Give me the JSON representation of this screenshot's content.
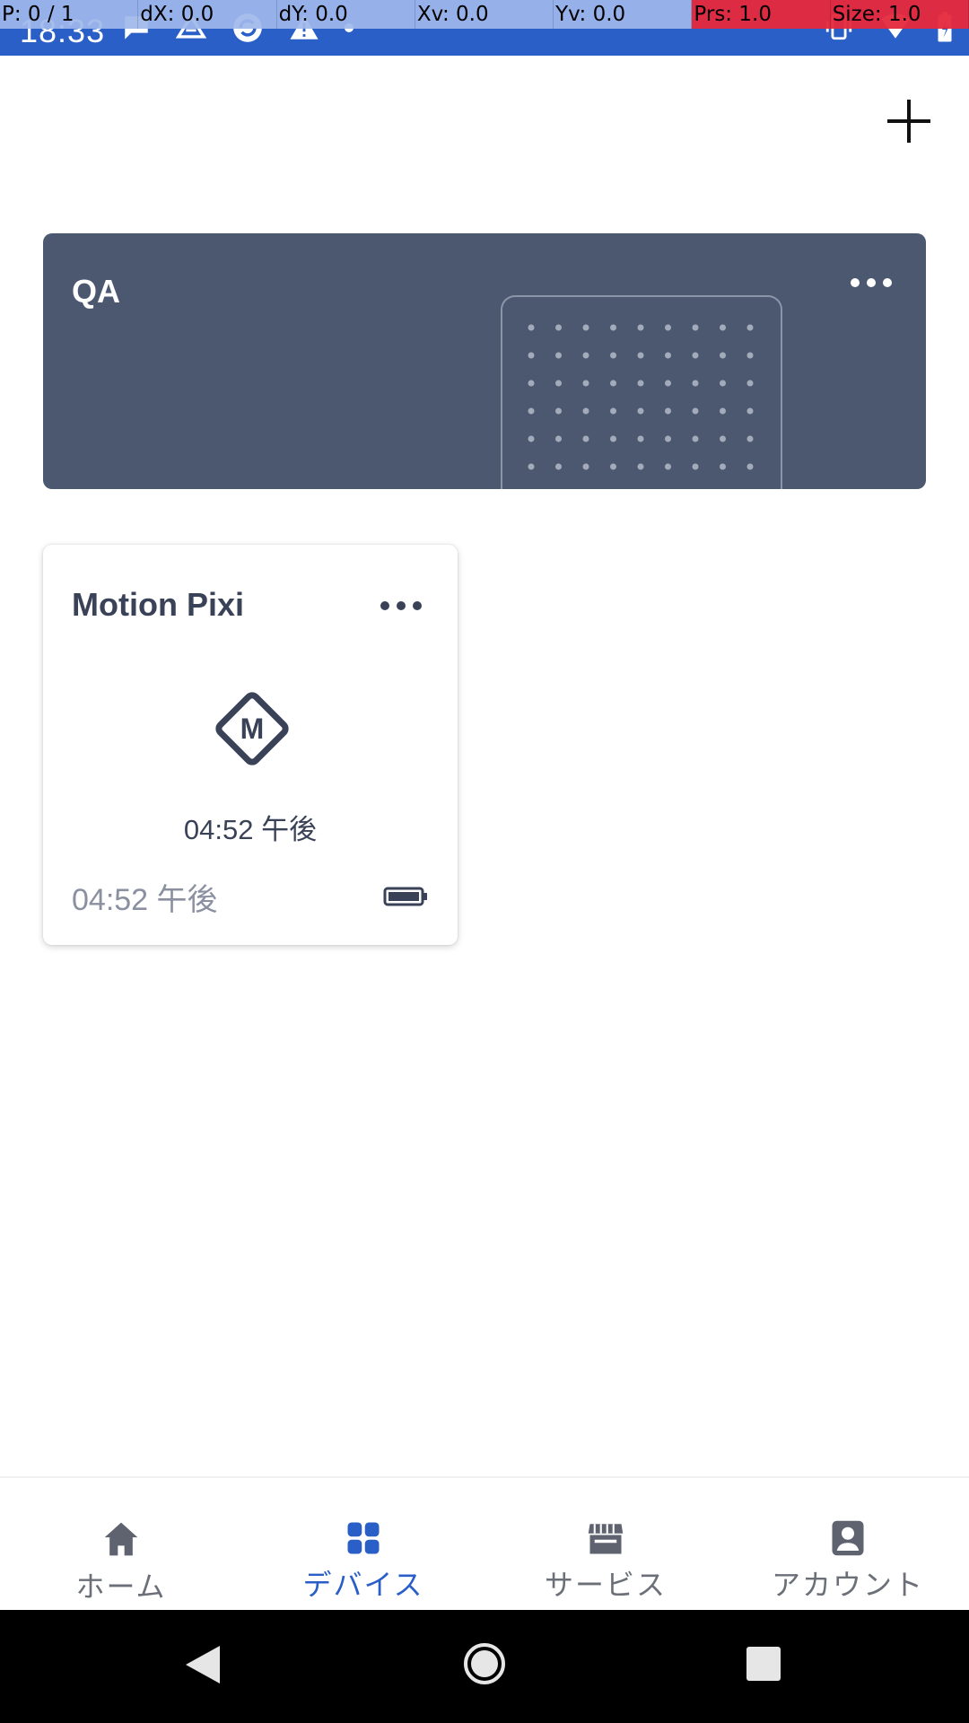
{
  "status_bar": {
    "time": "18:33",
    "left_icons": [
      "message-icon",
      "drive-icon",
      "sync-icon",
      "warning-icon",
      "dot-icon"
    ],
    "right_icons": [
      "vibrate-icon",
      "wifi-icon",
      "battery-charging-icon"
    ]
  },
  "pointer_overlay": [
    "P: 0 / 1",
    "dX: 0.0",
    "dY: 0.0",
    "Xv: 0.0",
    "Yv: 0.0",
    "Prs: 1.0",
    "Size: 1.0"
  ],
  "header": {
    "add_icon": "plus-icon"
  },
  "group": {
    "title": "QA",
    "more_icon": "more-horizontal-icon"
  },
  "device": {
    "name": "Motion Pixi",
    "logo_letter": "M",
    "last_seen_center": "04:52 午後",
    "last_seen_footer": "04:52 午後",
    "battery_icon": "battery-full-icon"
  },
  "bottom_nav": {
    "items": [
      {
        "label": "ホーム",
        "icon": "home-icon",
        "active": false
      },
      {
        "label": "デバイス",
        "icon": "devices-grid-icon",
        "active": true
      },
      {
        "label": "サービス",
        "icon": "store-icon",
        "active": false
      },
      {
        "label": "アカウント",
        "icon": "account-icon",
        "active": false
      }
    ]
  },
  "colors": {
    "accent": "#2a5fc7",
    "group_card": "#4b586f",
    "text_dark": "#3a4258",
    "text_muted": "#8a90a0"
  }
}
